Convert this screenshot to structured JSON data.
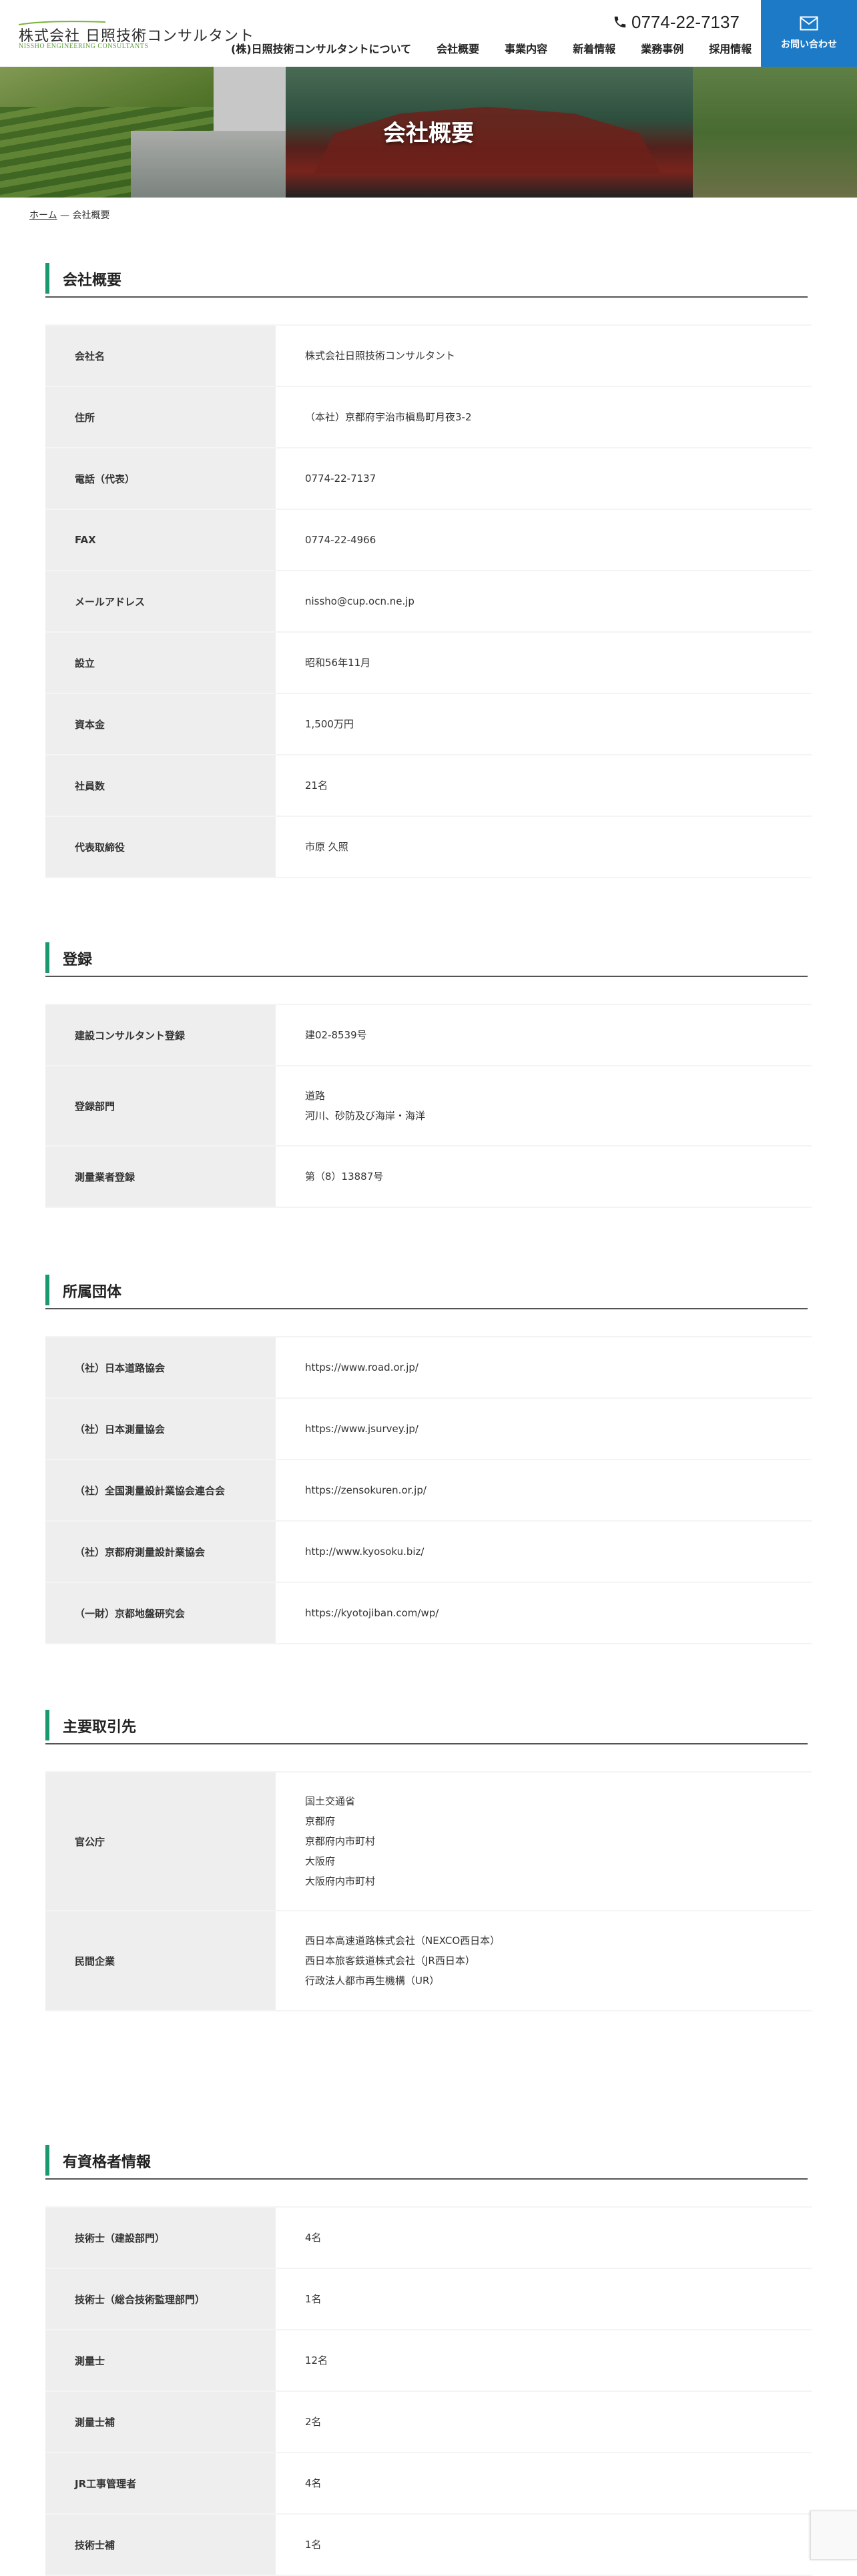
{
  "header": {
    "logo_name": "株式会社 日照技術コンサルタント",
    "logo_sub": "NISSHO ENGINEERING CONSULTANTS",
    "phone": "0774-22-7137",
    "nav": [
      "(株)日照技術コンサルタントについて",
      "会社概要",
      "事業内容",
      "新着情報",
      "業務事例",
      "採用情報"
    ],
    "contact_label": "お問い合わせ"
  },
  "hero": {
    "title": "会社概要"
  },
  "breadcrumb": {
    "home": "ホーム",
    "sep": "—",
    "current": "会社概要"
  },
  "sections": [
    {
      "title": "会社概要",
      "rows": [
        {
          "key": "会社名",
          "value": [
            "株式会社日照技術コンサルタント"
          ]
        },
        {
          "key": "住所",
          "value": [
            "（本社）京都府宇治市槇島町月夜3-2"
          ]
        },
        {
          "key": "電話（代表）",
          "value": [
            "0774-22-7137"
          ]
        },
        {
          "key": "FAX",
          "value": [
            "0774-22-4966"
          ]
        },
        {
          "key": "メールアドレス",
          "value": [
            "nissho@cup.ocn.ne.jp"
          ]
        },
        {
          "key": "設立",
          "value": [
            "昭和56年11月"
          ]
        },
        {
          "key": "資本金",
          "value": [
            "1,500万円"
          ]
        },
        {
          "key": "社員数",
          "value": [
            "21名"
          ]
        },
        {
          "key": "代表取締役",
          "value": [
            "市原 久照"
          ]
        }
      ]
    },
    {
      "title": "登録",
      "rows": [
        {
          "key": "建設コンサルタント登録",
          "value": [
            "建02-8539号"
          ]
        },
        {
          "key": "登録部門",
          "value": [
            "道路",
            "河川、砂防及び海岸・海洋"
          ]
        },
        {
          "key": "測量業者登録",
          "value": [
            "第（8）13887号"
          ]
        }
      ]
    },
    {
      "title": "所属団体",
      "rows": [
        {
          "key": "（社）日本道路協会",
          "value": [
            "https://www.road.or.jp/"
          ]
        },
        {
          "key": "（社）日本測量協会",
          "value": [
            "https://www.jsurvey.jp/"
          ]
        },
        {
          "key": "（社）全国測量設計業協会連合会",
          "value": [
            "https://zensokuren.or.jp/"
          ]
        },
        {
          "key": "（社）京都府測量設計業協会",
          "value": [
            "http://www.kyosoku.biz/"
          ]
        },
        {
          "key": "（一財）京都地盤研究会",
          "value": [
            "https://kyotojiban.com/wp/"
          ]
        }
      ]
    },
    {
      "title": "主要取引先",
      "rows": [
        {
          "key": "官公庁",
          "value": [
            "国土交通省",
            "京都府",
            "京都府内市町村",
            "大阪府",
            "大阪府内市町村"
          ]
        },
        {
          "key": "民間企業",
          "value": [
            "西日本高速道路株式会社（NEXCO西日本）",
            "西日本旅客鉄道株式会社（JR西日本）",
            "行政法人都市再生機構（UR）"
          ]
        }
      ]
    },
    {
      "title": "有資格者情報",
      "rows": [
        {
          "key": "技術士（建設部門）",
          "value": [
            "4名"
          ]
        },
        {
          "key": "技術士（総合技術監理部門）",
          "value": [
            "1名"
          ]
        },
        {
          "key": "測量士",
          "value": [
            "12名"
          ]
        },
        {
          "key": "測量士補",
          "value": [
            "2名"
          ]
        },
        {
          "key": "JR工事管理者",
          "value": [
            "4名"
          ]
        },
        {
          "key": "技術士補",
          "value": [
            "1名"
          ]
        }
      ]
    }
  ],
  "colors": {
    "accent_bar": "#1a9a6c",
    "contact_bg": "#1d7ac7"
  }
}
